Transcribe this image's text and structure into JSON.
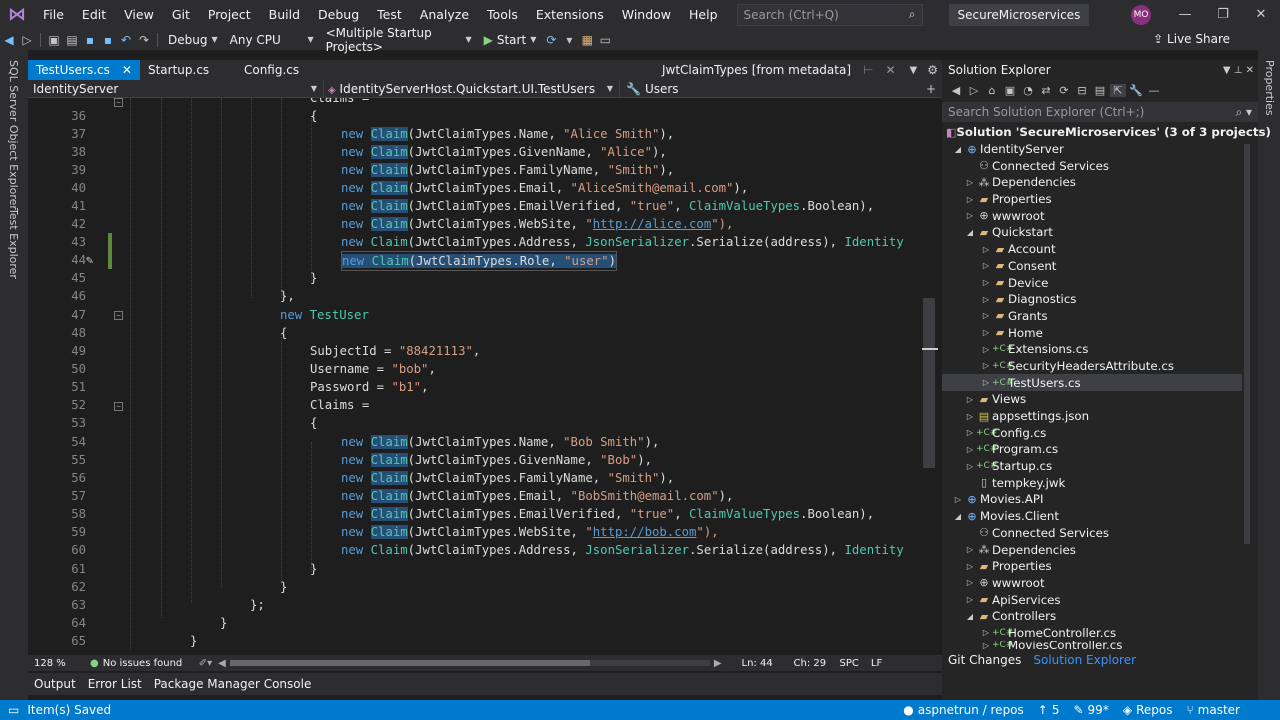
{
  "menu": [
    "File",
    "Edit",
    "View",
    "Git",
    "Project",
    "Build",
    "Debug",
    "Test",
    "Analyze",
    "Tools",
    "Extensions",
    "Window",
    "Help"
  ],
  "search_placeholder": "Search (Ctrl+Q)",
  "solution_title": "SecureMicroservices",
  "avatar": "MO",
  "toolbar": {
    "config": "Debug",
    "platform": "Any CPU",
    "startup": "<Multiple Startup Projects>",
    "start": "Start",
    "live_share": "Live Share"
  },
  "side_left": [
    "SQL Server Object Explorer",
    "Test Explorer"
  ],
  "side_right": "Properties",
  "tabs": {
    "t1": "TestUsers.cs",
    "t2": "Startup.cs",
    "t3": "Config.cs",
    "meta": "JwtClaimTypes [from metadata]"
  },
  "nav": {
    "project": "IdentityServer",
    "class": "IdentityServerHost.Quickstart.UI.TestUsers",
    "member": "Users"
  },
  "code": {
    "l35": "Claims =",
    "c_new": "new",
    "c_claim": "Claim",
    "c_jwt": "JwtClaimTypes",
    "c_cvt": "ClaimValueTypes",
    "c_json": "JsonSerializer",
    "l37_a": ".Name, ",
    "l37_s": "\"Alice Smith\"",
    "l37_e": "),",
    "l38_a": ".GivenName, ",
    "l38_s": "\"Alice\"",
    "l38_e": "),",
    "l39_a": ".FamilyName, ",
    "l39_s": "\"Smith\"",
    "l39_e": "),",
    "l40_a": ".Email, ",
    "l40_s": "\"AliceSmith@email.com\"",
    "l40_e": "),",
    "l41_a": ".EmailVerified, ",
    "l41_s": "\"true\"",
    "l41_b": ", ",
    "l41_c": ".Boolean),",
    "l42_a": ".WebSite, ",
    "l42_q": "\"",
    "l42_u": "http://alice.com",
    "l42_e": "\"),",
    "l43_a": ".Address, ",
    "l43_b": ".Serialize(address), ",
    "l43_c": "Identity",
    "l44_a": ".Role, ",
    "l44_s": "\"user\"",
    "l44_e": ")",
    "l45": "}",
    "l46": "},",
    "l47_t": "TestUser",
    "l48": "{",
    "l49_a": "SubjectId = ",
    "l49_s": "\"88421113\"",
    "l49_e": ",",
    "l50_a": "Username = ",
    "l50_s": "\"bob\"",
    "l50_e": ",",
    "l51_a": "Password = ",
    "l51_s": "\"b1\"",
    "l51_e": ",",
    "l52": "Claims =",
    "l53": "{",
    "l54_s": "\"Bob Smith\"",
    "l55_s": "\"Bob\"",
    "l56_s": "\"Smith\"",
    "l57_s": "\"BobSmith@email.com\"",
    "l59_u": "http://bob.com",
    "l61": "}",
    "l62": "}",
    "l63": "};",
    "l64": "}",
    "l65": "}",
    "l36": "{"
  },
  "line_numbers": [
    "36",
    "37",
    "38",
    "39",
    "40",
    "41",
    "42",
    "43",
    "44",
    "45",
    "46",
    "47",
    "48",
    "49",
    "50",
    "51",
    "52",
    "53",
    "54",
    "55",
    "56",
    "57",
    "58",
    "59",
    "60",
    "61",
    "62",
    "63",
    "64",
    "65"
  ],
  "editor_status": {
    "zoom": "128 %",
    "issues": "No issues found",
    "ln": "Ln: 44",
    "ch": "Ch: 29",
    "spc": "SPC",
    "lf": "LF"
  },
  "bottom_tabs": [
    "Output",
    "Error List",
    "Package Manager Console"
  ],
  "solution_explorer": {
    "title": "Solution Explorer",
    "search": "Search Solution Explorer (Ctrl+;)",
    "tree": [
      "Solution 'SecureMicroservices' (3 of 3 projects)",
      "IdentityServer",
      "Connected Services",
      "Dependencies",
      "Properties",
      "wwwroot",
      "Quickstart",
      "Account",
      "Consent",
      "Device",
      "Diagnostics",
      "Grants",
      "Home",
      "Extensions.cs",
      "SecurityHeadersAttribute.cs",
      "TestUsers.cs",
      "Views",
      "appsettings.json",
      "Config.cs",
      "Program.cs",
      "Startup.cs",
      "tempkey.jwk",
      "Movies.API",
      "Movies.Client",
      "Connected Services",
      "Dependencies",
      "Properties",
      "wwwroot",
      "ApiServices",
      "Controllers",
      "HomeController.cs",
      "MoviesController.cs"
    ],
    "tab_git": "Git Changes",
    "tab_se": "Solution Explorer"
  },
  "statusbar": {
    "left": "Item(s) Saved",
    "repo": "aspnetrun / repos",
    "changes": "5",
    "errors": "99*",
    "repos": "Repos",
    "branch": "master"
  }
}
